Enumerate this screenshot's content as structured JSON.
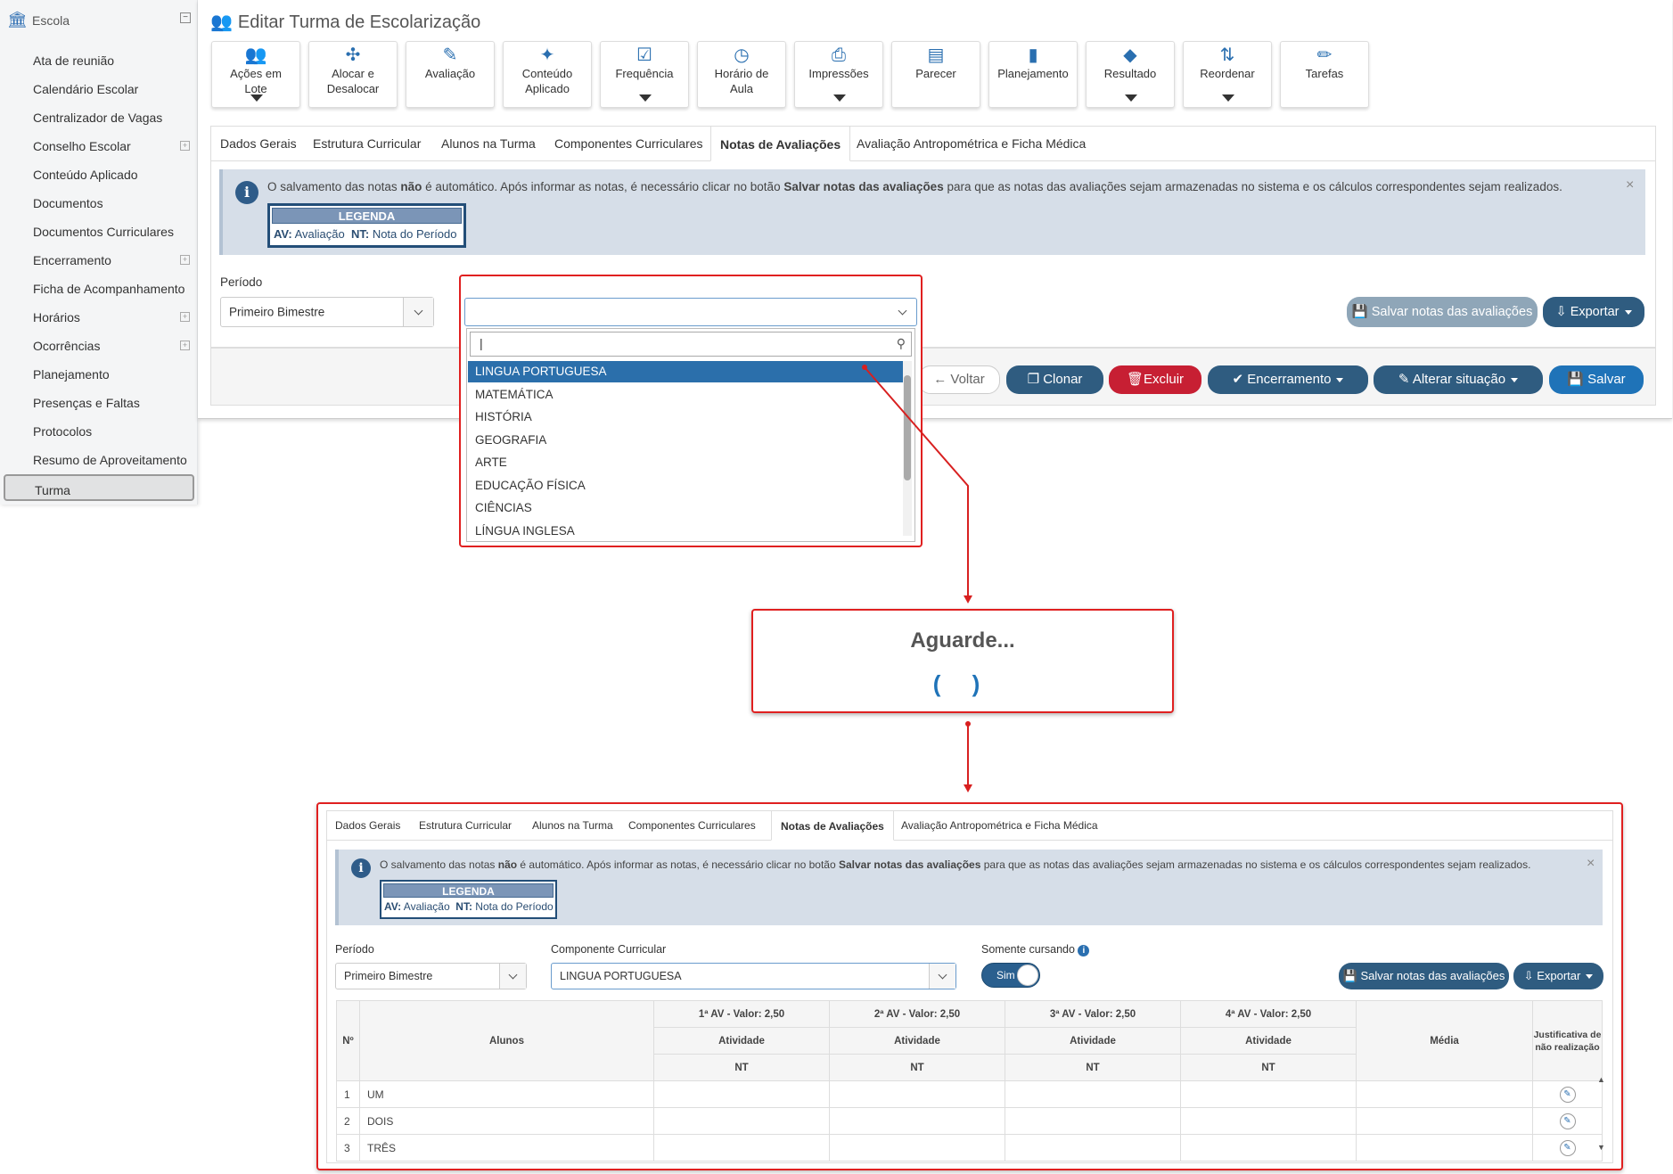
{
  "sidebar": {
    "header": "Escola",
    "items": [
      {
        "label": "Ata de reunião",
        "expand": false
      },
      {
        "label": "Calendário Escolar",
        "expand": false
      },
      {
        "label": "Centralizador de Vagas",
        "expand": false
      },
      {
        "label": "Conselho Escolar",
        "expand": true
      },
      {
        "label": "Conteúdo Aplicado",
        "expand": false
      },
      {
        "label": "Documentos",
        "expand": false
      },
      {
        "label": "Documentos Curriculares",
        "expand": false
      },
      {
        "label": "Encerramento",
        "expand": true
      },
      {
        "label": "Ficha de Acompanhamento",
        "expand": false
      },
      {
        "label": "Horários",
        "expand": true
      },
      {
        "label": "Ocorrências",
        "expand": true
      },
      {
        "label": "Planejamento",
        "expand": false
      },
      {
        "label": "Presenças e Faltas",
        "expand": false
      },
      {
        "label": "Protocolos",
        "expand": false
      },
      {
        "label": "Resumo de Aproveitamento",
        "expand": false
      },
      {
        "label": "Turma",
        "expand": false,
        "active": true
      }
    ]
  },
  "page": {
    "title": "Editar Turma de Escolarização"
  },
  "toolbar": [
    {
      "l1": "Ações em",
      "l2": "Lote",
      "caret": true,
      "icon": "users-icon"
    },
    {
      "l1": "Alocar e",
      "l2": "Desalocar",
      "caret": false,
      "icon": "puzzle-icon"
    },
    {
      "l1": "Avaliação",
      "l2": "",
      "caret": false,
      "icon": "edit-icon"
    },
    {
      "l1": "Conteúdo",
      "l2": "Aplicado",
      "caret": false,
      "icon": "magic-wand-icon"
    },
    {
      "l1": "Frequência",
      "l2": "",
      "caret": true,
      "icon": "check-square-icon"
    },
    {
      "l1": "Horário de",
      "l2": "Aula",
      "caret": false,
      "icon": "clock-icon"
    },
    {
      "l1": "Impressões",
      "l2": "",
      "caret": true,
      "icon": "printer-icon"
    },
    {
      "l1": "Parecer",
      "l2": "",
      "caret": false,
      "icon": "document-icon"
    },
    {
      "l1": "Planejamento",
      "l2": "",
      "caret": false,
      "icon": "book-icon"
    },
    {
      "l1": "Resultado",
      "l2": "",
      "caret": true,
      "icon": "graduation-cap-icon"
    },
    {
      "l1": "Reordenar",
      "l2": "",
      "caret": true,
      "icon": "sort-az-icon"
    },
    {
      "l1": "Tarefas",
      "l2": "",
      "caret": false,
      "icon": "pencil-icon"
    }
  ],
  "tabs": [
    "Dados Gerais",
    "Estrutura Curricular",
    "Alunos na Turma",
    "Componentes Curriculares",
    "Notas de Avaliações",
    "Avaliação Antropométrica e Ficha Médica"
  ],
  "alert": {
    "m1": "O salvamento das notas ",
    "m2": "não",
    "m3": " é automático. Após informar as notas, é necessário clicar no botão ",
    "m4": "Salvar notas das avaliações",
    "m5": " para que as notas das avaliações sejam armazenadas no sistema e os cálculos correspondentes sejam realizados.",
    "close": "×"
  },
  "legend": {
    "title": "LEGENDA",
    "av_key": "AV:",
    "av_val": " Avaliação",
    "nt_key": "NT:",
    "nt_val": " Nota do Período"
  },
  "filters": {
    "periodo_label": "Período",
    "periodo_value": "Primeiro Bimestre",
    "componente_label": "Componente Curricular",
    "componente_value": "LINGUA PORTUGUESA",
    "somente_label": "Somente cursando",
    "toggle_label": "Sim"
  },
  "buttons": {
    "salvar_notas": "Salvar notas das avaliações",
    "exportar": "Exportar",
    "voltar": "Voltar",
    "clonar": "Clonar",
    "excluir": "Excluir",
    "encerramento": "Encerramento",
    "alterar": "Alterar situação",
    "salvar": "Salvar"
  },
  "dropdown": {
    "options": [
      "LINGUA PORTUGUESA",
      "MATEMÁTICA",
      "HISTÓRIA",
      "GEOGRAFIA",
      "ARTE",
      "EDUCAÇÃO FÍSICA",
      "CIÊNCIAS",
      "LÍNGUA INGLESA"
    ],
    "selected": 0
  },
  "wait": {
    "title": "Aguarde...",
    "spinner": "( )"
  },
  "table": {
    "no": "Nº",
    "alunos": "Alunos",
    "av_cols": [
      "1ª AV - Valor: 2,50",
      "2ª AV - Valor: 2,50",
      "3ª AV - Valor: 2,50",
      "4ª AV - Valor: 2,50"
    ],
    "atividade": "Atividade",
    "nt": "NT",
    "media": "Média",
    "justificativa": "Justificativa de não realização",
    "rows": [
      {
        "n": "1",
        "nome": "UM"
      },
      {
        "n": "2",
        "nome": "DOIS"
      },
      {
        "n": "3",
        "nome": "TRÊS"
      }
    ]
  }
}
